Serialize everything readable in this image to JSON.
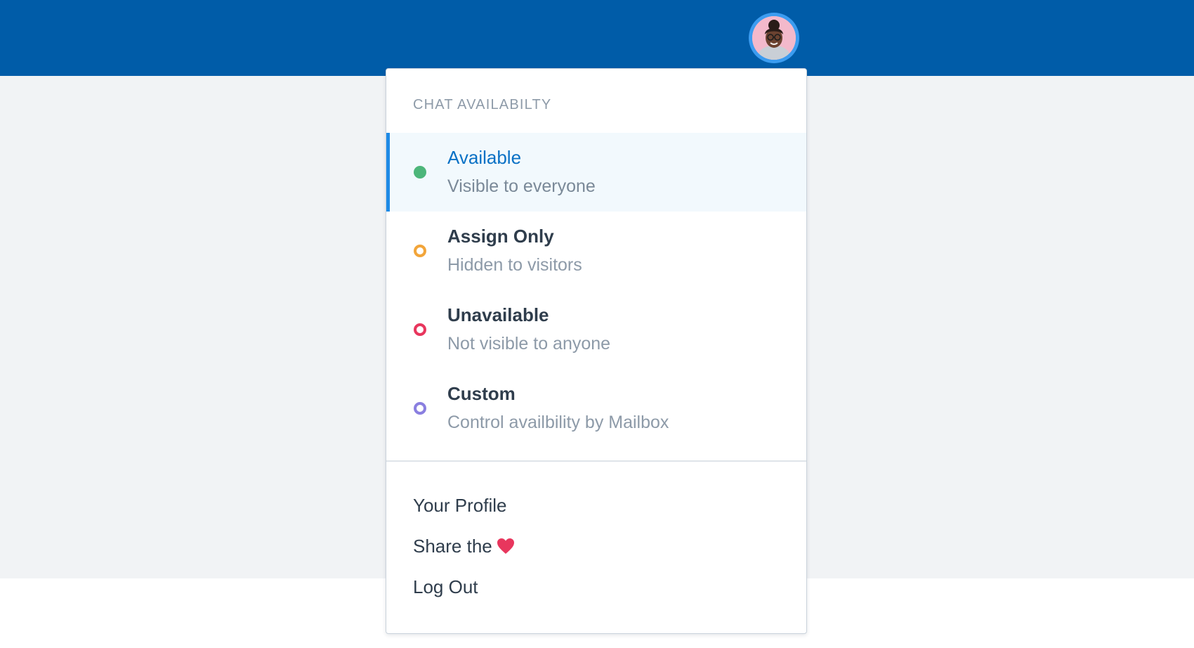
{
  "header": {
    "brand_color": "#005ca8",
    "avatar_icon": "user-avatar"
  },
  "dropdown": {
    "section_title": "CHAT AVAILABILTY",
    "statuses": [
      {
        "name": "Available",
        "description": "Visible to everyone",
        "color": "#4db67a",
        "selected": true
      },
      {
        "name": "Assign Only",
        "description": "Hidden to visitors",
        "color": "#f2a53a",
        "selected": false
      },
      {
        "name": "Unavailable",
        "description": "Not visible to anyone",
        "color": "#e8365d",
        "selected": false
      },
      {
        "name": "Custom",
        "description": "Control availbility by Mailbox",
        "color": "#8a7fe0",
        "selected": false
      }
    ],
    "links": {
      "profile": "Your Profile",
      "share": "Share the",
      "share_icon": "heart-icon",
      "share_icon_color": "#e8365d",
      "logout": "Log Out"
    }
  }
}
